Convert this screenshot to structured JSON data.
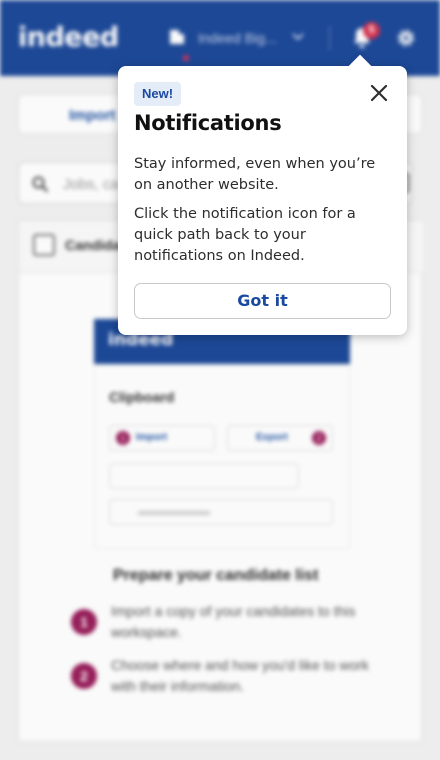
{
  "header": {
    "logo": "indeed",
    "org_name": "Indeed Big...",
    "notification_count": "5",
    "icons": [
      "building-icon",
      "chevron-down-icon",
      "bell-icon",
      "gear-icon"
    ]
  },
  "main": {
    "import_tab_label": "Import",
    "search_placeholder": "Jobs, ca",
    "list_header_label": "Candida",
    "illustration": {
      "logo": "indeed",
      "title": "Clipboard",
      "import_label": "Import",
      "export_label": "Export",
      "step_badge_1": "1",
      "step_badge_2": "2"
    },
    "prepare_title": "Prepare your candidate list",
    "steps": [
      {
        "num": "1",
        "text": "Import a copy of your candidates to this workspace."
      },
      {
        "num": "2",
        "text": "Choose where and how you'd like to work with their information."
      }
    ]
  },
  "popover": {
    "badge": "New!",
    "title": "Notifications",
    "paragraph1": "Stay informed, even when you’re on another website.",
    "paragraph2": "Click the notification icon for a quick path back to your notifications on Indeed.",
    "button_label": "Got it"
  },
  "colors": {
    "brand_blue": "#1e4a9a",
    "badge_red": "#d8334f",
    "accent_magenta": "#9a1f5c",
    "link_blue": "#1a4aa0"
  }
}
